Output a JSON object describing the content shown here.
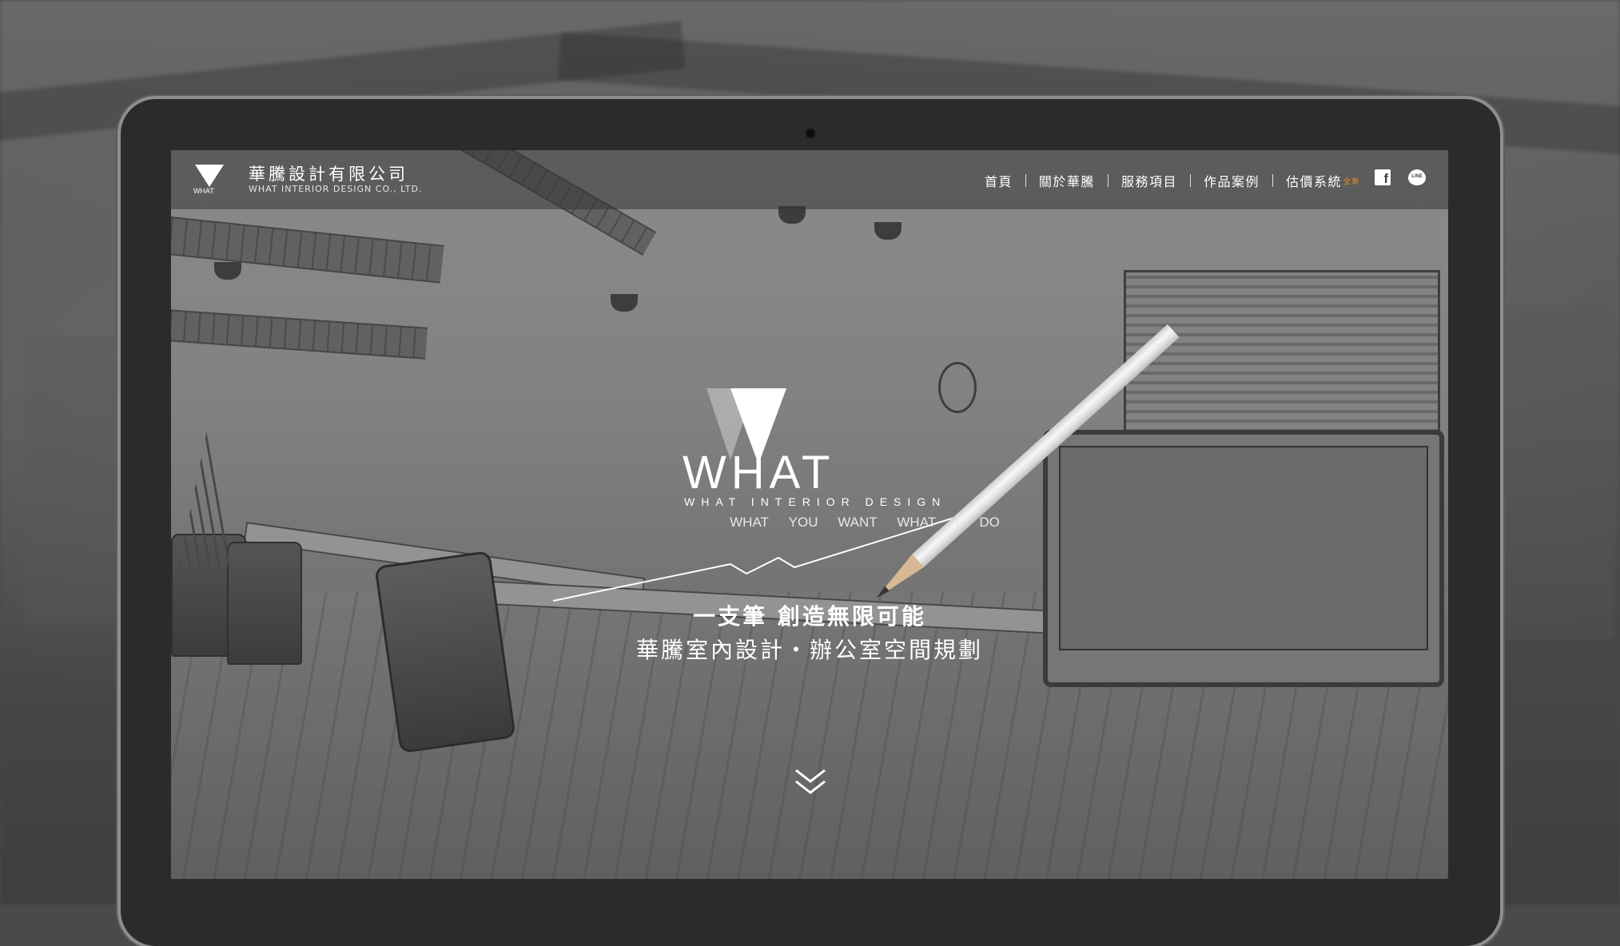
{
  "brand": {
    "name": "華騰設計有限公司",
    "subtitle": "WHAT INTERIOR DESIGN CO., LTD."
  },
  "nav": {
    "items": [
      {
        "label": "首頁"
      },
      {
        "label": "關於華騰"
      },
      {
        "label": "服務項目"
      },
      {
        "label": "作品案例"
      },
      {
        "label": "估價系統",
        "badge": "全新"
      }
    ],
    "badge_color": "#ff8a1d"
  },
  "social": {
    "facebook_icon": "facebook-icon",
    "line_icon": "line-icon",
    "line_label": "LINE"
  },
  "hero": {
    "wordmark": "WHAT",
    "wordmark_sub": "WHAT INTERIOR DESIGN",
    "motto_words": [
      "WHAT",
      "YOU",
      "WANT",
      "WHAT",
      "I",
      "DO"
    ],
    "line1": "一支筆 創造無限可能",
    "line2": "華騰室內設計・辦公室空間規劃",
    "scroll_icon": "double-chevron-down-icon"
  }
}
